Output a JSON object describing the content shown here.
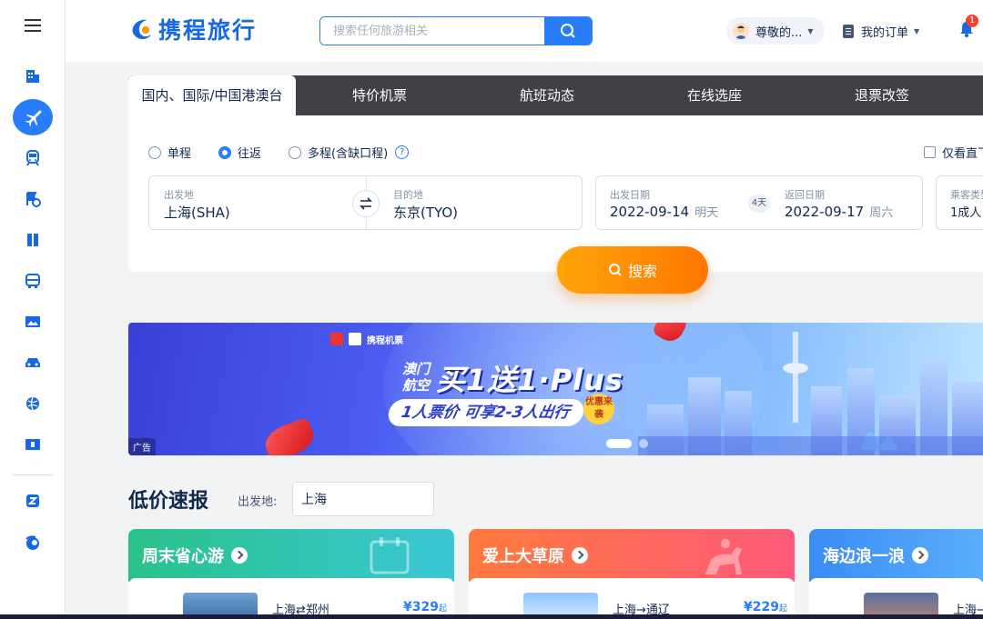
{
  "sidebar": {
    "items": [
      {
        "name": "menu-icon"
      },
      {
        "name": "hotel-icon"
      },
      {
        "name": "flight-icon",
        "active": true
      },
      {
        "name": "train-icon"
      },
      {
        "name": "travel-package-icon"
      },
      {
        "name": "guide-icon"
      },
      {
        "name": "bus-icon"
      },
      {
        "name": "photo-icon"
      },
      {
        "name": "car-icon"
      },
      {
        "name": "globe-icon"
      },
      {
        "name": "ticket-icon"
      },
      {
        "name": "business-icon"
      },
      {
        "name": "ctrip-logo-icon"
      }
    ]
  },
  "header": {
    "logo_text": "携程旅行",
    "search_placeholder": "搜索任何旅游相关",
    "user_name": "尊敬的...",
    "orders_label": "我的订单",
    "notification_count": "1"
  },
  "search_panel": {
    "tabs": [
      {
        "label": "国内、国际/中国港澳台",
        "active": true
      },
      {
        "label": "特价机票"
      },
      {
        "label": "航班动态"
      },
      {
        "label": "在线选座"
      },
      {
        "label": "退票改签"
      }
    ],
    "trip_types": [
      {
        "label": "单程",
        "selected": false
      },
      {
        "label": "往返",
        "selected": true
      },
      {
        "label": "多程(含缺口程)",
        "selected": false
      }
    ],
    "help_glyph": "?",
    "direct_only_label": "仅看直飞",
    "from_label": "出发地",
    "from_value": "上海(SHA)",
    "to_label": "目的地",
    "to_value": "东京(TYO)",
    "depart_label": "出发日期",
    "depart_date": "2022-09-14",
    "depart_weekday": "明天",
    "duration": "4天",
    "return_label": "返回日期",
    "return_date": "2022-09-17",
    "return_weekday": "周六",
    "passenger_label": "乘客类型",
    "passenger_value": "1成人",
    "search_button": "搜索"
  },
  "banner": {
    "brand_text": "携程机票",
    "side_text": "澳门航空",
    "headline": "买1送1·Plus",
    "subline": "1人票价 可享2-3人出行",
    "badge": "优惠来袭",
    "ad_tag": "广告",
    "slide_count": 2,
    "active_slide": 1
  },
  "low_price": {
    "title": "低价速报",
    "origin_label": "出发地:",
    "origin_value": "上海",
    "cards": [
      {
        "title": "周末省心游",
        "route": "上海⇄郑州",
        "price": "¥329",
        "price_suffix": "起",
        "colors": [
          "#2ac28a",
          "#3bc7d6"
        ]
      },
      {
        "title": "爱上大草原",
        "route": "上海→通辽",
        "price": "¥229",
        "price_suffix": "起",
        "colors": [
          "#ff7a3d",
          "#ff5a7a"
        ]
      },
      {
        "title": "海边浪一浪",
        "route": "上海→",
        "price": "",
        "price_suffix": "",
        "colors": [
          "#3b8cf5",
          "#5aaefc"
        ]
      }
    ]
  },
  "colors": {
    "accent": "#287dfa",
    "search_orange": "#ff7700",
    "tab_bar": "#3f4144",
    "text_primary": "#0f294d"
  }
}
